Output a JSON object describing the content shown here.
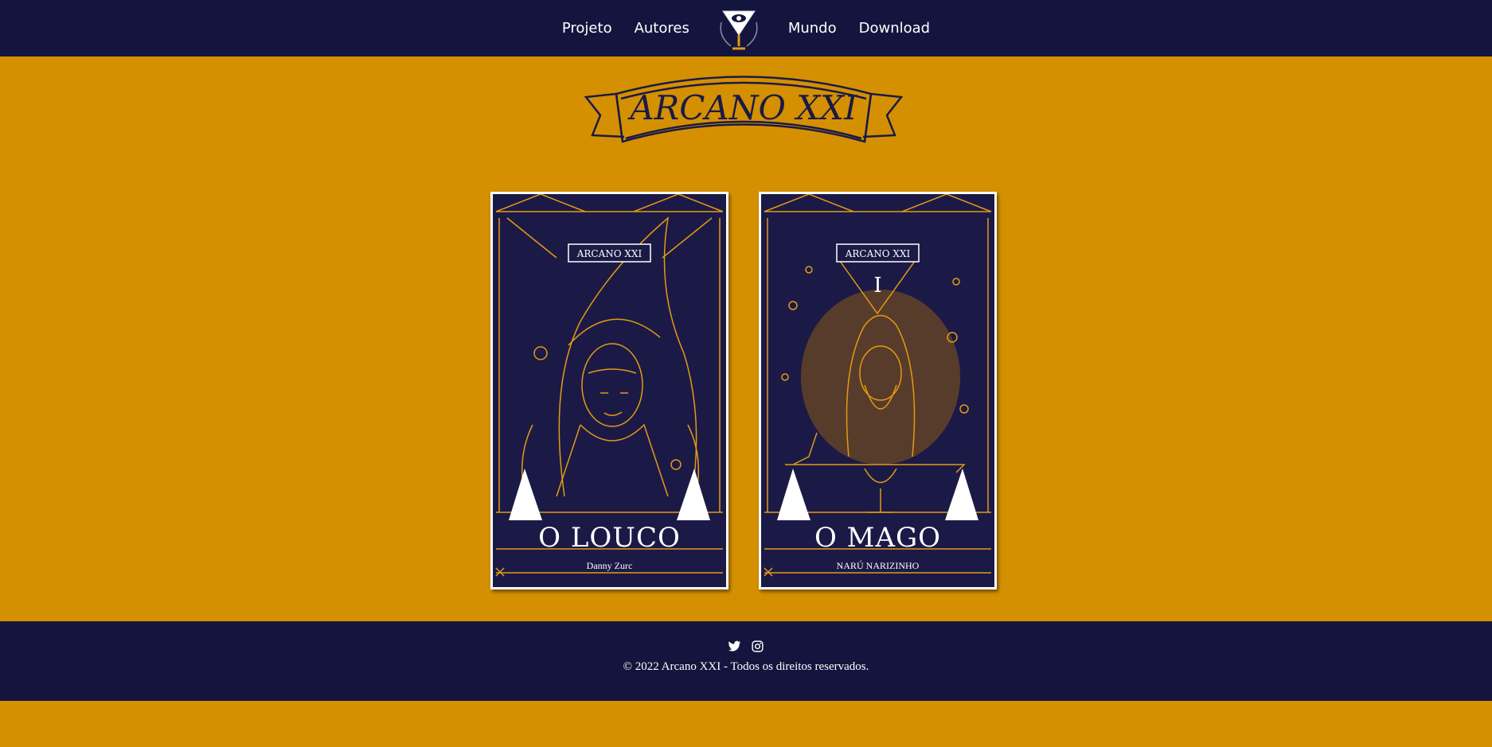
{
  "colors": {
    "page_background": "#d49000",
    "navbar": "#14153e",
    "card_background": "#1b1a47",
    "card_line": "#e49a12",
    "text_light": "#ffffff"
  },
  "nav": {
    "items": [
      "Projeto",
      "Autores",
      "Mundo",
      "Download"
    ],
    "logo_icon": "eye-chalice-logo-icon"
  },
  "banner": {
    "title": "ARCANO XXI"
  },
  "cards": [
    {
      "header": "ARCANO XXI",
      "numeral": "",
      "name": "O LOUCO",
      "author": "Danny Zurc",
      "art_icon": "fool-portrait-icon"
    },
    {
      "header": "ARCANO XXI",
      "numeral": "I",
      "name": "O MAGO",
      "author": "NARÚ NARIZINHO",
      "art_icon": "magician-portrait-icon"
    }
  ],
  "footer": {
    "social_icons": [
      "twitter-icon",
      "instagram-icon"
    ],
    "copyright": "© 2022 Arcano XXI - Todos os direitos reservados."
  }
}
